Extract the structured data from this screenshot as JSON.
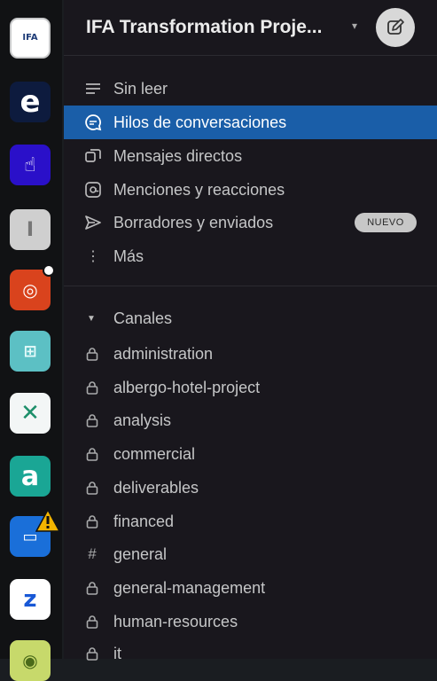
{
  "workspace": {
    "name": "IFA Transformation Proje...",
    "logo_text": "IFA"
  },
  "rail": {
    "workspaces": [
      {
        "name": "ifa-workspace",
        "glyph": ""
      },
      {
        "name": "e-workspace",
        "glyph": "e"
      },
      {
        "name": "hand-workspace",
        "glyph": "☝"
      },
      {
        "name": "i-workspace",
        "glyph": "I"
      },
      {
        "name": "orange-workspace",
        "glyph": "◎"
      },
      {
        "name": "grid-workspace",
        "glyph": "⊞"
      },
      {
        "name": "x-workspace",
        "glyph": "✕"
      },
      {
        "name": "a-workspace",
        "glyph": "a"
      },
      {
        "name": "doc-workspace",
        "glyph": "▭"
      },
      {
        "name": "z-workspace",
        "glyph": "z"
      },
      {
        "name": "green-workspace",
        "glyph": "◉"
      }
    ]
  },
  "nav": [
    {
      "label": "Sin leer",
      "icon": "unread-icon"
    },
    {
      "label": "Hilos de conversaciones",
      "icon": "threads-icon",
      "active": true
    },
    {
      "label": "Mensajes directos",
      "icon": "direct-messages-icon"
    },
    {
      "label": "Menciones y reacciones",
      "icon": "mentions-icon"
    },
    {
      "label": "Borradores y enviados",
      "icon": "send-icon",
      "badge": "NUEVO"
    },
    {
      "label": "Más",
      "icon": "more-icon"
    }
  ],
  "channels_section": {
    "label": "Canales"
  },
  "channels": [
    {
      "name": "administration",
      "icon": "lock-icon"
    },
    {
      "name": "albergo-hotel-project",
      "icon": "lock-icon"
    },
    {
      "name": "analysis",
      "icon": "lock-icon"
    },
    {
      "name": "commercial",
      "icon": "lock-icon"
    },
    {
      "name": "deliverables",
      "icon": "lock-icon"
    },
    {
      "name": "financed",
      "icon": "lock-icon"
    },
    {
      "name": "general",
      "icon": "hash-icon"
    },
    {
      "name": "general-management",
      "icon": "lock-icon"
    },
    {
      "name": "human-resources",
      "icon": "lock-icon"
    },
    {
      "name": "it",
      "icon": "lock-icon"
    }
  ],
  "colors": {
    "active": "#1a5ea8",
    "sidebar": "#19171d",
    "rail": "#111214"
  }
}
